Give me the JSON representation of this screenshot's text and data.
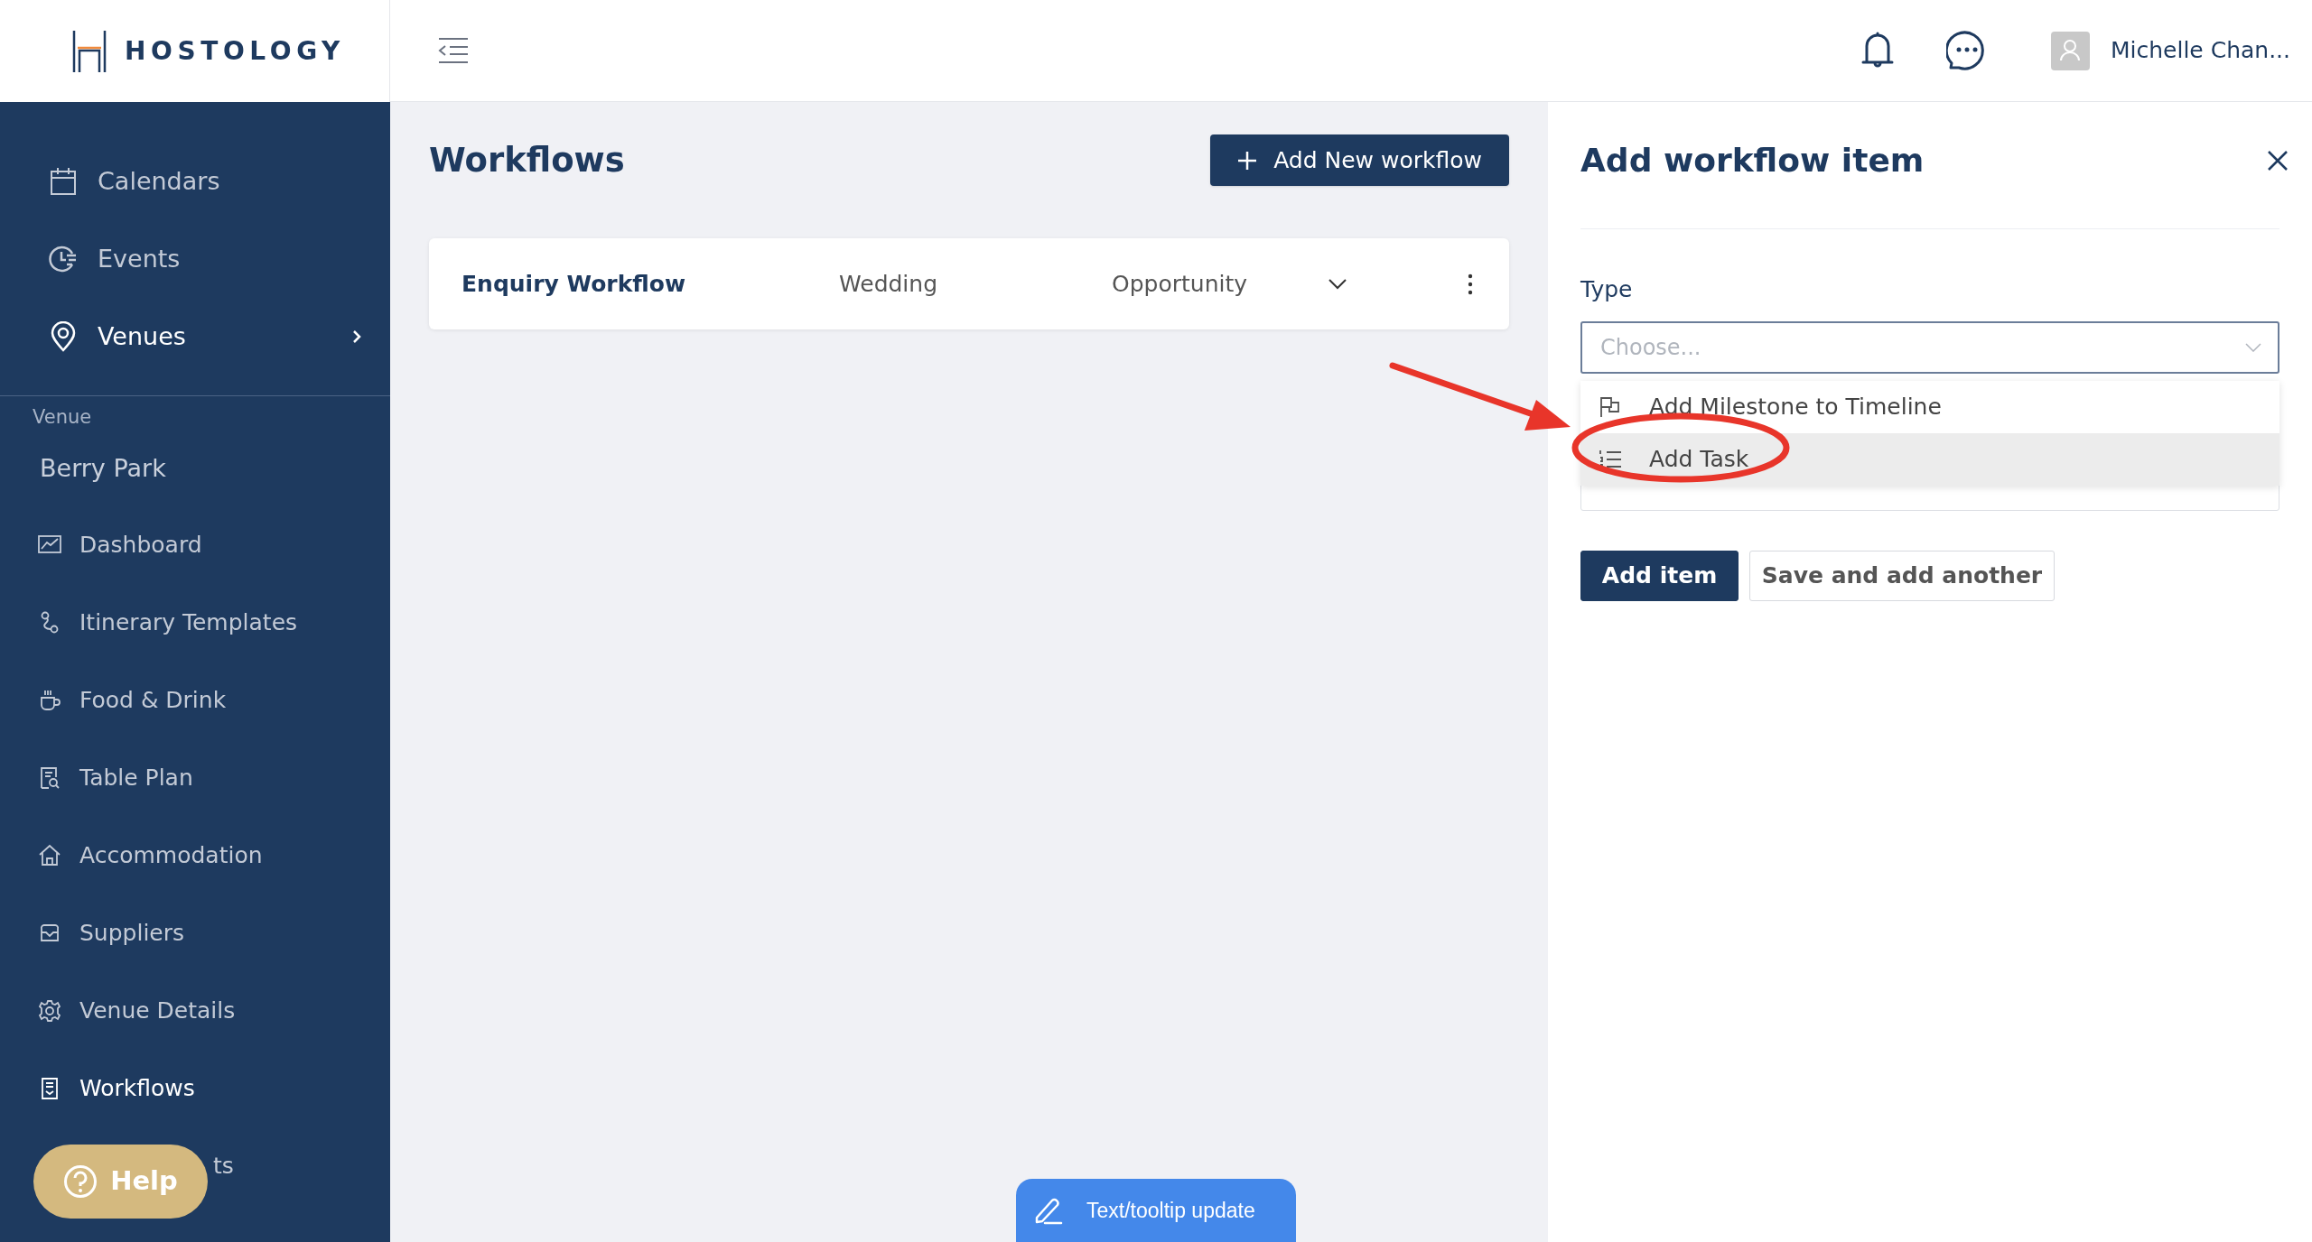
{
  "logo": {
    "text": "HOSTOLOGY"
  },
  "top_bar": {
    "user_name": "Michelle Chan..."
  },
  "sidebar": {
    "items": [
      {
        "label": "Calendars",
        "selected": false,
        "has_submenu": false
      },
      {
        "label": "Events",
        "selected": false,
        "has_submenu": false
      },
      {
        "label": "Venues",
        "selected": true,
        "has_submenu": true
      }
    ],
    "section_label": "Venue",
    "venue_name": "Berry Park",
    "venue_items": [
      {
        "label": "Dashboard",
        "selected": false,
        "kind": "link"
      },
      {
        "label": "Itinerary Templates",
        "selected": false,
        "kind": "link"
      },
      {
        "label": "Food & Drink",
        "selected": false,
        "kind": "link"
      },
      {
        "label": "Table Plan",
        "selected": false,
        "kind": "link"
      },
      {
        "label": "Accommodation",
        "selected": false,
        "kind": "link"
      },
      {
        "label": "Suppliers",
        "selected": false,
        "kind": "link"
      },
      {
        "label": "Venue Details",
        "selected": false,
        "kind": "link"
      },
      {
        "label": "Workflows",
        "selected": true,
        "kind": "link"
      },
      {
        "label": "ts",
        "selected": false,
        "kind": "covered"
      }
    ]
  },
  "main": {
    "title": "Workflows",
    "add_button": "Add New workflow",
    "workflows": [
      {
        "name": "Enquiry Workflow",
        "type": "Wedding",
        "stage": "Opportunity"
      }
    ]
  },
  "panel": {
    "title": "Add workflow item",
    "type_label": "Type",
    "select": {
      "placeholder": "Choose..."
    },
    "options": [
      {
        "label": "Add Milestone to Timeline",
        "selected": false
      },
      {
        "label": "Add Task",
        "selected": true
      }
    ],
    "buttons": [
      {
        "label": "Add item",
        "kind": "primary"
      },
      {
        "label": "Save and add another",
        "kind": "secondary"
      }
    ]
  },
  "help_button": "Help",
  "feedback_button": "Text/tooltip update"
}
